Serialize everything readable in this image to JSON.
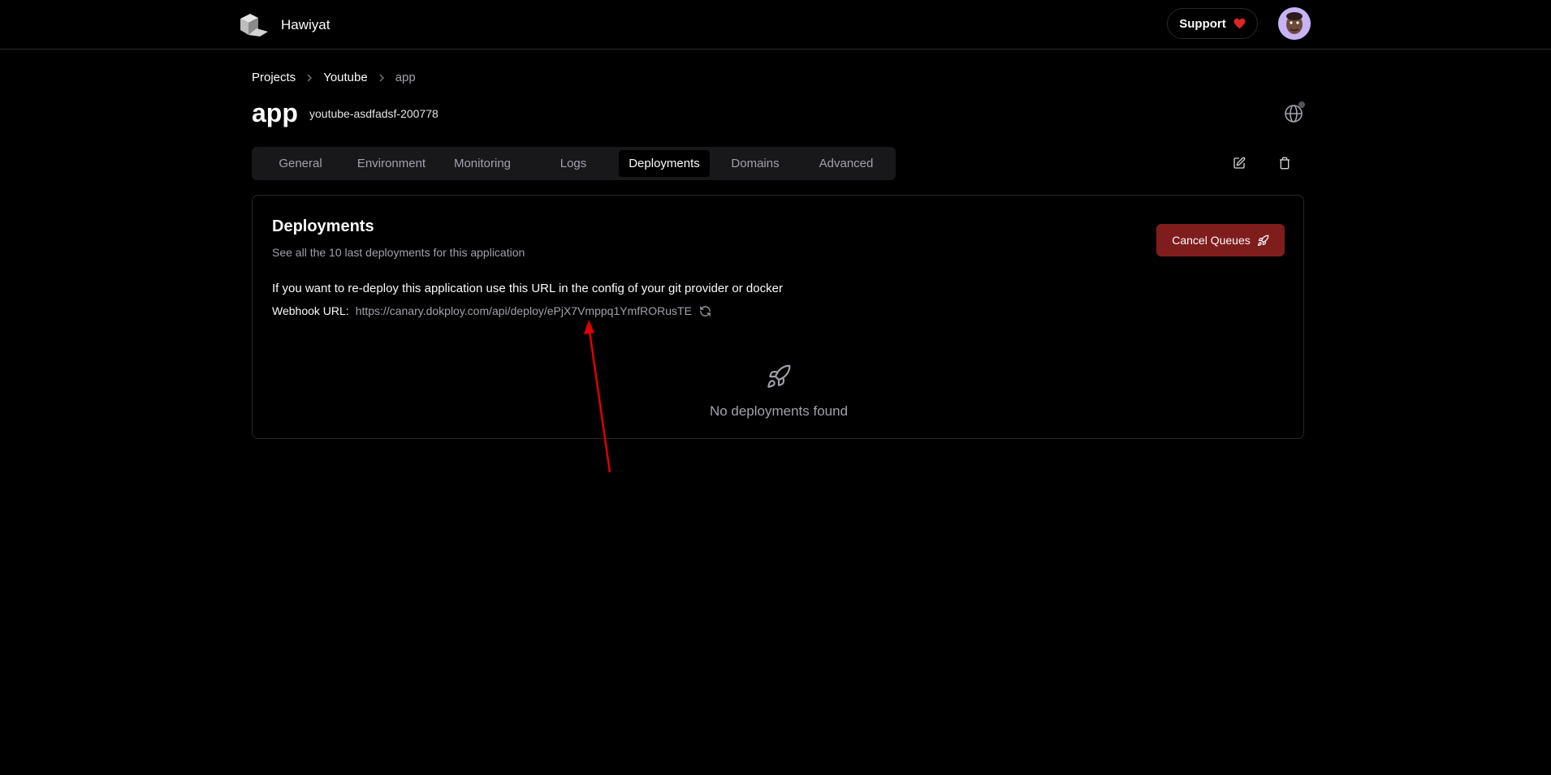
{
  "header": {
    "brand": "Hawiyat",
    "support_label": "Support"
  },
  "breadcrumb": {
    "items": [
      "Projects",
      "Youtube",
      "app"
    ]
  },
  "page": {
    "title": "app",
    "slug": "youtube-asdfadsf-200778"
  },
  "tabs": [
    {
      "label": "General"
    },
    {
      "label": "Environment"
    },
    {
      "label": "Monitoring"
    },
    {
      "label": "Logs"
    },
    {
      "label": "Deployments",
      "active": true
    },
    {
      "label": "Domains"
    },
    {
      "label": "Advanced"
    }
  ],
  "deployments": {
    "title": "Deployments",
    "subtitle": "See all the 10 last deployments for this application",
    "cancel_label": "Cancel Queues",
    "redeploy_text": "If you want to re-deploy this application use this URL in the config of your git provider or docker",
    "webhook_label": "Webhook URL:",
    "webhook_url": "https://canary.dokploy.com/api/deploy/ePjX7Vmppq1YmfRORusTE",
    "empty_text": "No deployments found"
  },
  "colors": {
    "accent_danger": "#7f1d1d",
    "support_heart": "#dc2626",
    "annotation_arrow": "#e00000"
  },
  "icons": {
    "logo": "cube-logo-icon",
    "support": "heart-icon",
    "globe": "globe-icon",
    "edit": "edit-icon",
    "delete": "trash-icon",
    "cancel": "rocket-icon",
    "refresh": "refresh-icon",
    "empty": "rocket-icon"
  }
}
